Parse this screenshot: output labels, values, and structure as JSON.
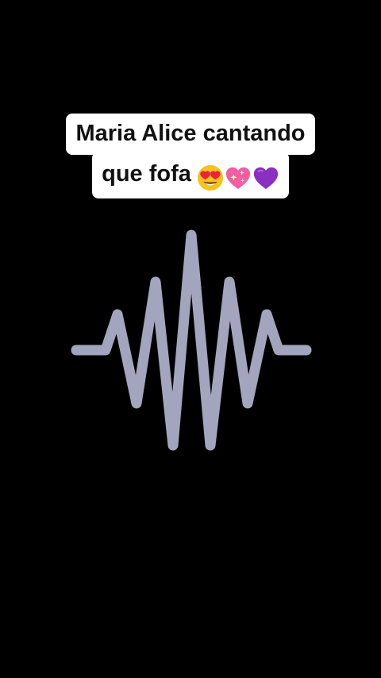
{
  "caption": {
    "line1": "Maria Alice cantando",
    "line2": "que fofa",
    "emojis": [
      "heart-eyes-emoji",
      "sparkling-heart-emoji",
      "purple-heart-emoji"
    ]
  },
  "colors": {
    "background": "#000000",
    "caption_bg": "#ffffff",
    "caption_text": "#111111",
    "waveform": "#a3a4bd"
  },
  "waveform": {
    "icon": "sound-wave-icon"
  }
}
